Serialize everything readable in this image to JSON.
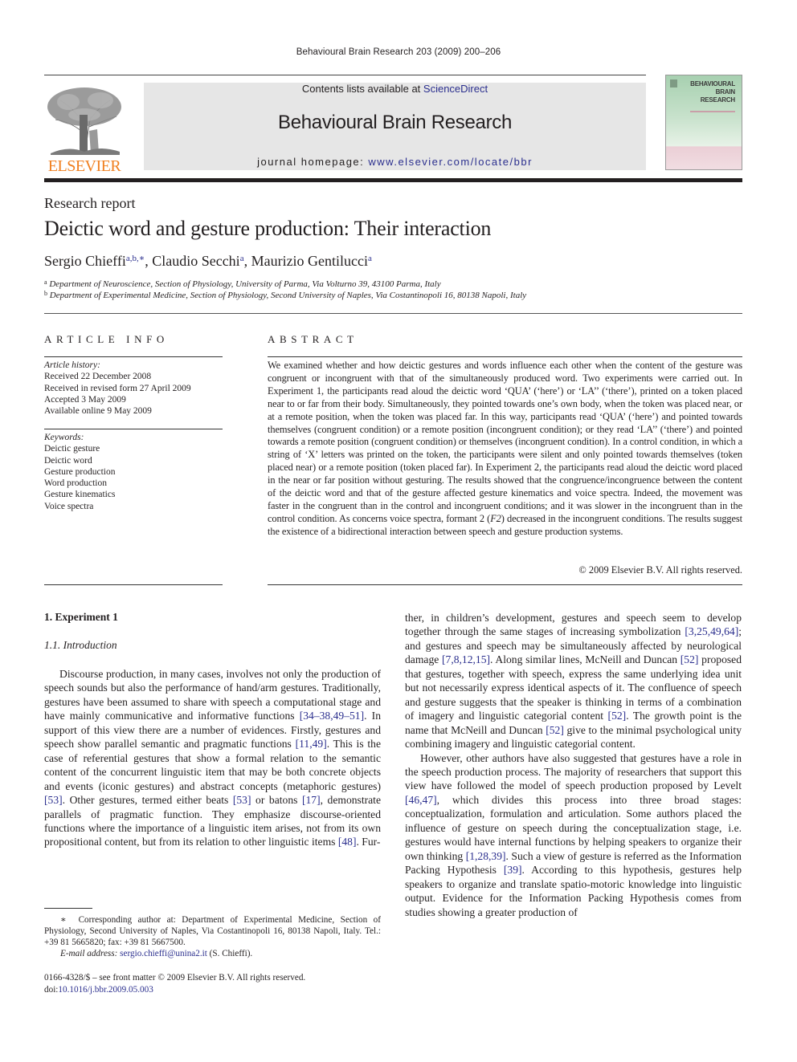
{
  "running_head": "Behavioural Brain Research 203 (2009) 200–206",
  "masthead": {
    "contents_prefix": "Contents lists available at ",
    "contents_link": "ScienceDirect",
    "journal_title": "Behavioural Brain Research",
    "homepage_prefix": "journal homepage: ",
    "homepage_url": "www.elsevier.com/locate/bbr",
    "publisher_word": "ELSEVIER",
    "cover_title_lines": [
      "BEHAVIOURAL",
      "BRAIN",
      "RESEARCH"
    ],
    "colors": {
      "link": "#2b2f8e",
      "publisher_orange": "#f07f1f",
      "masthead_bg": "#e6e6e6"
    }
  },
  "article": {
    "type": "Research report",
    "title": "Deictic word and gesture production: Their interaction",
    "authors": [
      {
        "name": "Sergio Chieffi",
        "sup": "a,b,∗",
        "sep": ", "
      },
      {
        "name": "Claudio Secchi",
        "sup": "a",
        "sep": ", "
      },
      {
        "name": "Maurizio Gentilucci",
        "sup": "a",
        "sep": ""
      }
    ],
    "affiliations": [
      {
        "mark": "a",
        "text": "Department of Neuroscience, Section of Physiology, University of Parma, Via Volturno 39, 43100 Parma, Italy"
      },
      {
        "mark": "b",
        "text": "Department of Experimental Medicine, Section of Physiology, Second University of Naples, Via Costantinopoli 16, 80138 Napoli, Italy"
      }
    ]
  },
  "article_info": {
    "heading": "ARTICLE INFO",
    "history_label": "Article history:",
    "history": [
      "Received 22 December 2008",
      "Received in revised form 27 April 2009",
      "Accepted 3 May 2009",
      "Available online 9 May 2009"
    ],
    "keywords_label": "Keywords:",
    "keywords": [
      "Deictic gesture",
      "Deictic word",
      "Gesture production",
      "Word production",
      "Gesture kinematics",
      "Voice spectra"
    ]
  },
  "abstract": {
    "heading": "ABSTRACT",
    "text_part1": "We examined whether and how deictic gestures and words influence each other when the content of the gesture was congruent or incongruent with that of the simultaneously produced word. Two experiments were carried out. In Experiment 1, the participants read aloud the deictic word ‘QUA’ (‘here’) or ‘LA’’ (‘there’), printed on a token placed near to or far from their body. Simultaneously, they pointed towards one’s own body, when the token was placed near, or at a remote position, when the token was placed far. In this way, participants read ‘QUA’ (‘here’) and pointed towards themselves (congruent condition) or a remote position (incongruent condition); or they read ‘LA’’ (‘there’) and pointed towards a remote position (congruent condition) or themselves (incongruent condition). In a control condition, in which a string of ‘X’ letters was printed on the token, the participants were silent and only pointed towards themselves (token placed near) or a remote position (token placed far). In Experiment 2, the participants read aloud the deictic word placed in the near or far position without gesturing. The results showed that the congruence/incongruence between the content of the deictic word and that of the gesture affected gesture kinematics and voice spectra. Indeed, the movement was faster in the congruent than in the control and incongruent conditions; and it was slower in the incongruent than in the control condition. As concerns voice spectra, formant 2 (",
    "text_italic": "F2",
    "text_part2": ") decreased in the incongruent conditions. The results suggest the existence of a bidirectional interaction between speech and gesture production systems.",
    "copyright": "© 2009 Elsevier B.V. All rights reserved."
  },
  "body": {
    "section1_heading": "1.  Experiment 1",
    "section11_heading": "1.1.  Introduction",
    "col1": [
      {
        "t": "Discourse production, in many cases, involves not only the production of speech sounds but also the performance of hand/arm gestures. Traditionally, gestures have been assumed to share with speech a computational stage and have mainly communicative and informative functions "
      },
      {
        "c": "[34–38,49–51]"
      },
      {
        "t": ". In support of this view there are a number of evidences. Firstly, gestures and speech show parallel semantic and pragmatic functions "
      },
      {
        "c": "[11,49]"
      },
      {
        "t": ". This is the case of referential gestures that show a formal relation to the semantic content of the concurrent linguistic item that may be both concrete objects and events (iconic gestures) and abstract concepts (metaphoric gestures) "
      },
      {
        "c": "[53]"
      },
      {
        "t": ". Other gestures, termed either beats "
      },
      {
        "c": "[53]"
      },
      {
        "t": " or batons "
      },
      {
        "c": "[17]"
      },
      {
        "t": ", demonstrate parallels of pragmatic function. They emphasize discourse-oriented functions where the importance of a linguistic item arises, not from its own propositional content, but from its relation to other linguistic items "
      },
      {
        "c": "[48]"
      },
      {
        "t": ". Fur-"
      }
    ],
    "col2_p1": [
      {
        "t": "ther, in children’s development, gestures and speech seem to develop together through the same stages of increasing symbolization "
      },
      {
        "c": "[3,25,49,64]"
      },
      {
        "t": "; and gestures and speech may be simultaneously affected by neurological damage "
      },
      {
        "c": "[7,8,12,15]"
      },
      {
        "t": ". Along similar lines, McNeill and Duncan "
      },
      {
        "c": "[52]"
      },
      {
        "t": " proposed that gestures, together with speech, express the same underlying idea unit but not necessarily express identical aspects of it. The confluence of speech and gesture suggests that the speaker is thinking in terms of a combination of imagery and linguistic categorial content "
      },
      {
        "c": "[52]"
      },
      {
        "t": ". The growth point is the name that McNeill and Duncan "
      },
      {
        "c": "[52]"
      },
      {
        "t": " give to the minimal psychological unity combining imagery and linguistic categorial content."
      }
    ],
    "col2_p2": [
      {
        "t": "However, other authors have also suggested that gestures have a role in the speech production process. The majority of researchers that support this view have followed the model of speech production proposed by Levelt "
      },
      {
        "c": "[46,47]"
      },
      {
        "t": ", which divides this process into three broad stages: conceptualization, formulation and articulation. Some authors placed the influence of gesture on speech during the conceptualization stage, i.e. gestures would have internal functions by helping speakers to organize their own thinking "
      },
      {
        "c": "[1,28,39]"
      },
      {
        "t": ". Such a view of gesture is referred as the Information Packing Hypothesis "
      },
      {
        "c": "[39]"
      },
      {
        "t": ". According to this hypothesis, gestures help speakers to organize and translate spatio-motoric knowledge into linguistic output. Evidence for the Information Packing Hypothesis comes from studies showing a greater production of"
      }
    ]
  },
  "footnote": {
    "mark": "∗",
    "text": "Corresponding author at: Department of Experimental Medicine, Section of Physiology, Second University of Naples, Via Costantinopoli 16, 80138 Napoli, Italy. Tel.: +39 81 5665820; fax: +39 81 5667500.",
    "email_label": "E-mail address:",
    "email": "sergio.chieffi@unina2.it",
    "email_suffix": " (S. Chieffi)."
  },
  "front_matter": {
    "issn_line": "0166-4328/$ – see front matter © 2009 Elsevier B.V. All rights reserved.",
    "doi_prefix": "doi:",
    "doi": "10.1016/j.bbr.2009.05.003"
  }
}
